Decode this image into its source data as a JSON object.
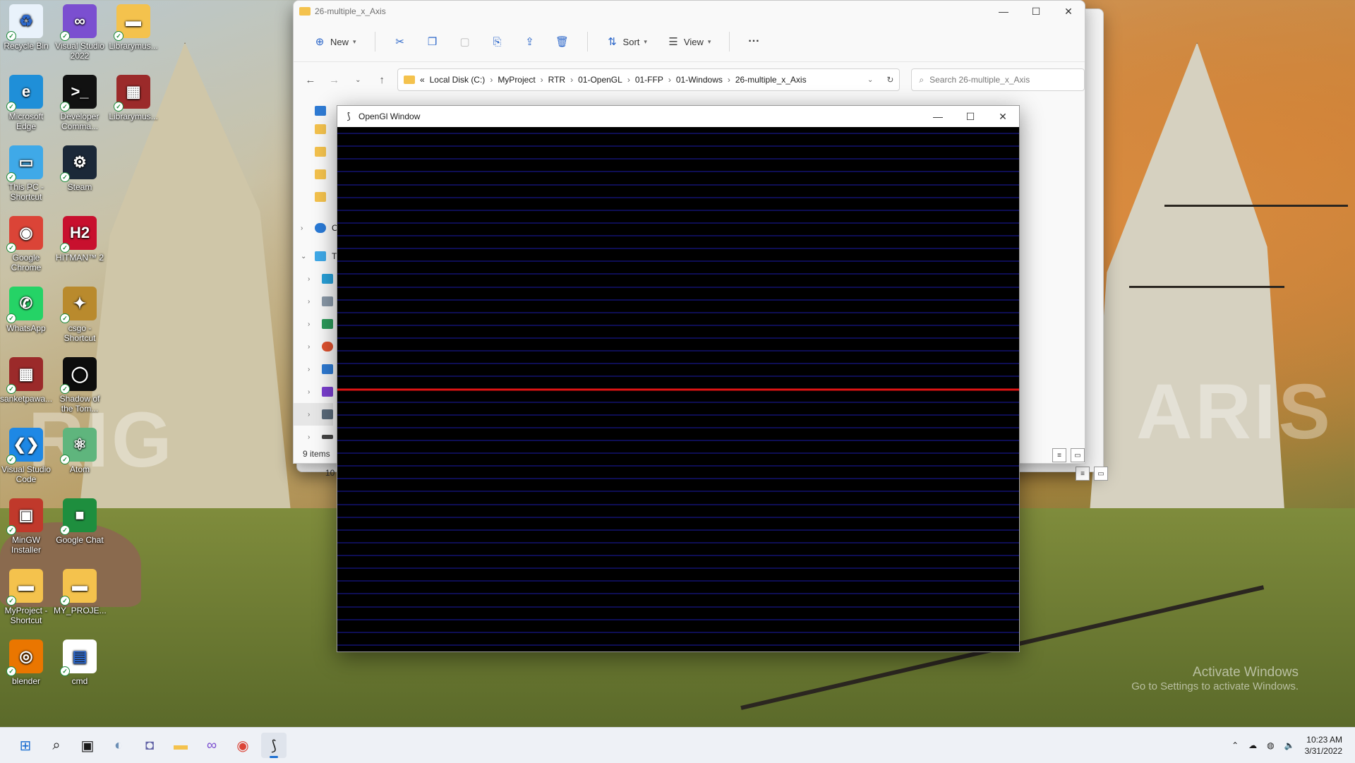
{
  "desktop": {
    "icons": [
      {
        "label": "Recycle Bin",
        "glyph": "♻",
        "color": "#e9f2fb"
      },
      {
        "label": "Visual Studio 2022",
        "glyph": "∞",
        "color": "#7b4fd0"
      },
      {
        "label": "Librarymus...",
        "glyph": "▬",
        "color": "#f4c24d"
      },
      {
        "label": "Microsoft Edge",
        "glyph": "e",
        "color": "#1f8fd8"
      },
      {
        "label": "Developer Comma...",
        "glyph": ">_",
        "color": "#111111"
      },
      {
        "label": "Librarymus...",
        "glyph": "▦",
        "color": "#9b2a2a"
      },
      {
        "label": "This PC - Shortcut",
        "glyph": "▭",
        "color": "#3fa9e8"
      },
      {
        "label": "Steam",
        "glyph": "⚙",
        "color": "#1b2838"
      },
      {
        "label": "Google Chrome",
        "glyph": "◉",
        "color": "#db4437"
      },
      {
        "label": "HITMAN™ 2",
        "glyph": "H2",
        "color": "#c8102e"
      },
      {
        "label": "WhatsApp",
        "glyph": "✆",
        "color": "#25d366"
      },
      {
        "label": "csgo - Shortcut",
        "glyph": "✦",
        "color": "#b98a2d"
      },
      {
        "label": "sanketpawa...",
        "glyph": "▦",
        "color": "#9b2a2a"
      },
      {
        "label": "Shadow of the Tom...",
        "glyph": "◯",
        "color": "#0d0d0d"
      },
      {
        "label": "Visual Studio Code",
        "glyph": "❮❯",
        "color": "#1e88e5"
      },
      {
        "label": "Atom",
        "glyph": "⚛",
        "color": "#5fb57d"
      },
      {
        "label": "MinGW Installer",
        "glyph": "▣",
        "color": "#c0392b"
      },
      {
        "label": "Google Chat",
        "glyph": "■",
        "color": "#1e8e3e"
      },
      {
        "label": "MyProject - Shortcut",
        "glyph": "▬",
        "color": "#f4c24d"
      },
      {
        "label": "MY_PROJE...",
        "glyph": "▬",
        "color": "#f4c24d"
      },
      {
        "label": "blender",
        "glyph": "◎",
        "color": "#ea7600"
      },
      {
        "label": "cmd",
        "glyph": "▤",
        "color": "#ffffff"
      }
    ],
    "watermark_left": "RIG",
    "watermark_right": "ARIS",
    "activate_line1": "Activate Windows",
    "activate_line2": "Go to Settings to activate Windows."
  },
  "explorer": {
    "title": "26-multiple_x_Axis",
    "toolbar": {
      "new_label": "New",
      "sort_label": "Sort",
      "view_label": "View",
      "more_label": "···"
    },
    "address": {
      "overflow": "«",
      "crumbs": [
        "Local Disk (C:)",
        "MyProject",
        "RTR",
        "01-OpenGL",
        "01-FFP",
        "01-Windows",
        "26-multiple_x_Axis"
      ]
    },
    "search_placeholder": "Search 26-multiple_x_Axis",
    "nav_visible": [
      "O",
      "Th"
    ],
    "items_count": "9 items",
    "back_items_count": "10 it"
  },
  "gl_window": {
    "title": "OpenGl Window",
    "background": "#000000",
    "line_color": "#1c1ca8",
    "x_axis_color": "#e01414",
    "line_count": 41,
    "x_axis_index": 20
  },
  "taskbar": {
    "icons": [
      {
        "name": "start-icon",
        "glyph": "⊞",
        "color": "#1d6fd1"
      },
      {
        "name": "search-icon",
        "glyph": "⌕",
        "color": "#1a1a1a"
      },
      {
        "name": "task-view-icon",
        "glyph": "▣",
        "color": "#1a1a1a"
      },
      {
        "name": "widgets-icon",
        "glyph": "◐",
        "color": "#6b8fb5"
      },
      {
        "name": "teams-chat-icon",
        "glyph": "◘",
        "color": "#6264a7"
      },
      {
        "name": "file-explorer-icon",
        "glyph": "▬",
        "color": "#f4c24d"
      },
      {
        "name": "visual-studio-icon",
        "glyph": "∞",
        "color": "#7b4fd0"
      },
      {
        "name": "chrome-icon",
        "glyph": "◉",
        "color": "#db4437"
      },
      {
        "name": "opengl-app-icon",
        "glyph": "⟆",
        "color": "#222222"
      }
    ],
    "tray": {
      "chevron": "⌃",
      "time": "10:23 AM",
      "date": "3/31/2022"
    }
  }
}
